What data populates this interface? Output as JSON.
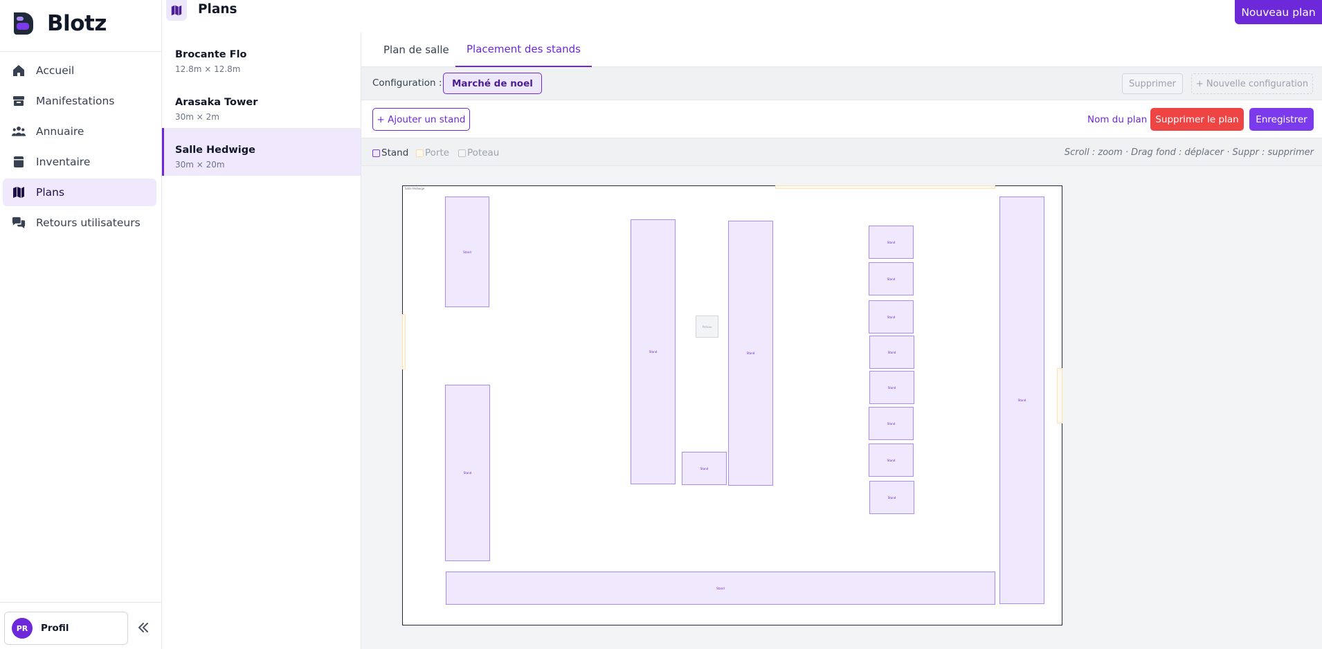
{
  "app": {
    "name": "Blotz"
  },
  "sidebar": {
    "items": [
      {
        "label": "Accueil",
        "icon": "home-icon",
        "active": false
      },
      {
        "label": "Manifestations",
        "icon": "store-icon",
        "active": false
      },
      {
        "label": "Annuaire",
        "icon": "users-icon",
        "active": false
      },
      {
        "label": "Inventaire",
        "icon": "box-icon",
        "active": false
      },
      {
        "label": "Plans",
        "icon": "map-icon",
        "active": true
      },
      {
        "label": "Retours utilisateurs",
        "icon": "chat-icon",
        "active": false
      }
    ],
    "profile": {
      "initials": "PR",
      "label": "Profil"
    },
    "collapse_icon": "chevrons-left-icon"
  },
  "header": {
    "title": "Plans",
    "icon": "map-icon",
    "new_button": "Nouveau plan"
  },
  "plans": [
    {
      "name": "Brocante Flo",
      "size": "12.8m × 12.8m",
      "active": false
    },
    {
      "name": "Arasaka Tower",
      "size": "30m × 2m",
      "active": false
    },
    {
      "name": "Salle Hedwige",
      "size": "30m × 20m",
      "active": true
    }
  ],
  "tabs": [
    {
      "label": "Plan de salle",
      "active": false
    },
    {
      "label": "Placement des stands",
      "active": true
    }
  ],
  "config": {
    "label": "Configuration :",
    "selected": "Marché de noel",
    "delete_label": "Supprimer",
    "new_label": "+ Nouvelle configuration"
  },
  "toolbar": {
    "add_stand": "+ Ajouter un stand",
    "plan_name": "Nom du plan",
    "delete_plan": "Supprimer le plan",
    "save": "Enregistrer"
  },
  "legend": [
    {
      "label": "Stand",
      "color": "#7c3aed",
      "fill": "#f0e9fd",
      "text_color": "#374151"
    },
    {
      "label": "Porte",
      "color": "#fcd7a5",
      "fill": "#fffaf0",
      "text_color": "#9ca3af"
    },
    {
      "label": "Poteau",
      "color": "#c4c4c4",
      "fill": "#f3f4f6",
      "text_color": "#9ca3af"
    }
  ],
  "hint": "Scroll : zoom · Drag fond : déplacer · Suppr : supprimer",
  "canvas": {
    "label": "Salle Hedwige",
    "stand_label": "Stand",
    "pole_label": "Poteau"
  },
  "colors": {
    "accent": "#6d28d9",
    "danger": "#ef4444",
    "active_bg": "#f0e9fd"
  }
}
